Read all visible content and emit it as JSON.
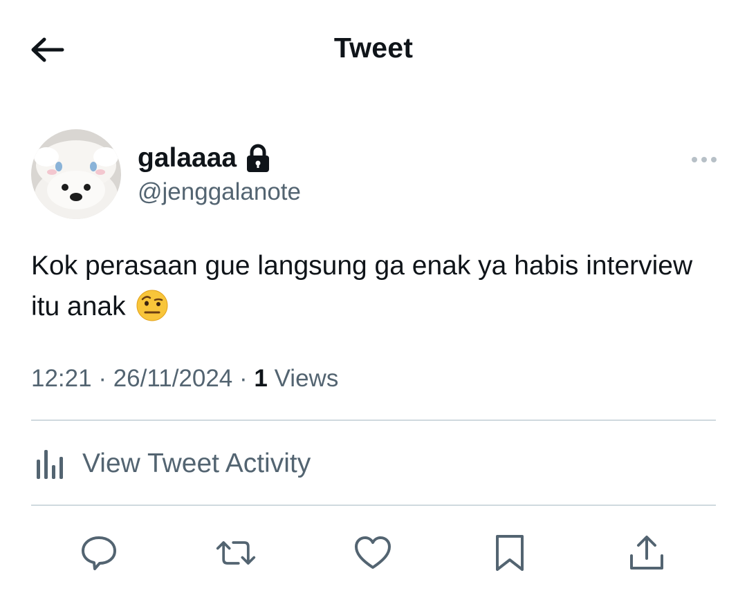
{
  "header": {
    "title": "Tweet"
  },
  "author": {
    "display_name": "galaaaa",
    "handle": "@jenggalanote",
    "protected": true
  },
  "tweet": {
    "text": "Kok perasaan gue langsung ga enak ya habis interview itu anak",
    "emoji": "🤨",
    "time": "12:21",
    "date": "26/11/2024",
    "views_count": "1",
    "views_label": "Views"
  },
  "activity": {
    "label": "View Tweet Activity"
  },
  "actions": [
    "reply",
    "retweet",
    "like",
    "bookmark",
    "share"
  ],
  "colors": {
    "text": "#0f1419",
    "secondary": "#536471",
    "divider": "#cfd9de"
  }
}
